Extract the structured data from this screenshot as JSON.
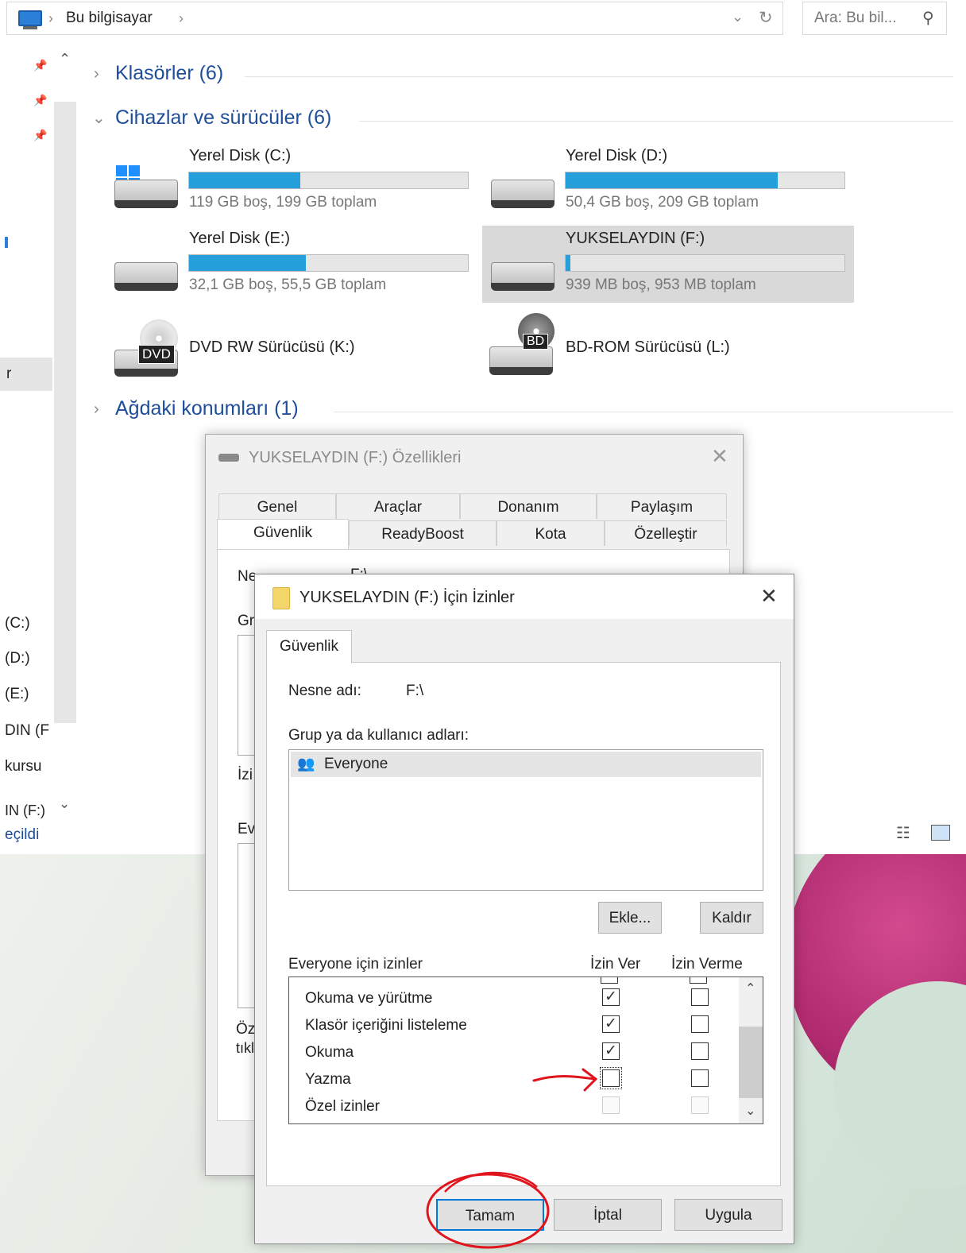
{
  "explorer": {
    "breadcrumb": "Bu bilgisayar",
    "search_placeholder": "Ara: Bu bil...",
    "sections": {
      "folders": "Klasörler (6)",
      "devices": "Cihazlar ve sürücüler (6)",
      "network": "Ağdaki konumları (1)"
    },
    "drives": [
      {
        "name": "Yerel Disk (C:)",
        "free_text": "119 GB boş, 199 GB toplam",
        "used_fraction": 0.4
      },
      {
        "name": "Yerel Disk (D:)",
        "free_text": "50,4 GB boş, 209 GB toplam",
        "used_fraction": 0.76
      },
      {
        "name": "Yerel Disk (E:)",
        "free_text": "32,1 GB boş, 55,5 GB toplam",
        "used_fraction": 0.42
      },
      {
        "name": "YUKSELAYDIN (F:)",
        "free_text": "939 MB boş, 953 MB toplam",
        "used_fraction": 0.015
      },
      {
        "name": "DVD RW Sürücüsü (K:)",
        "badge": "DVD"
      },
      {
        "name": "BD-ROM Sürücüsü (L:)",
        "badge": "BD"
      }
    ],
    "sidebar_fragments": [
      "r",
      "(C:)",
      "(D:)",
      "(E:)",
      "DIN (F",
      "kursu",
      "IN (F:)"
    ],
    "status_fragment": "eçildi"
  },
  "properties_dialog": {
    "title": "YUKSELAYDIN (F:) Özellikleri",
    "tabs_row1": [
      "Genel",
      "Araçlar",
      "Donanım",
      "Paylaşım"
    ],
    "tabs_row2": [
      "Güvenlik",
      "ReadyBoost",
      "Kota",
      "Özelleştir"
    ],
    "fragments": [
      "Ne",
      "Gr",
      "İzi",
      "Ev",
      "Öz",
      "tıkl"
    ],
    "obj_fragment": "F:\\"
  },
  "permissions_dialog": {
    "title": "YUKSELAYDIN (F:) İçin İzinler",
    "tab": "Güvenlik",
    "object_label": "Nesne adı:",
    "object_value": "F:\\",
    "group_label": "Grup ya da kullanıcı adları:",
    "users": [
      "Everyone"
    ],
    "add_button": "Ekle...",
    "remove_button": "Kaldır",
    "perm_header": "Everyone için izinler",
    "allow_header": "İzin Ver",
    "deny_header": "İzin Verme",
    "permissions": [
      {
        "name": "Okuma ve yürütme",
        "allow": true,
        "deny": false
      },
      {
        "name": "Klasör içeriğini listeleme",
        "allow": true,
        "deny": false
      },
      {
        "name": "Okuma",
        "allow": true,
        "deny": false
      },
      {
        "name": "Yazma",
        "allow": false,
        "deny": false
      },
      {
        "name": "Özel izinler",
        "allow": false,
        "deny": false,
        "disabled": true
      }
    ],
    "ok_button": "Tamam",
    "cancel_button": "İptal",
    "apply_button": "Uygula"
  }
}
